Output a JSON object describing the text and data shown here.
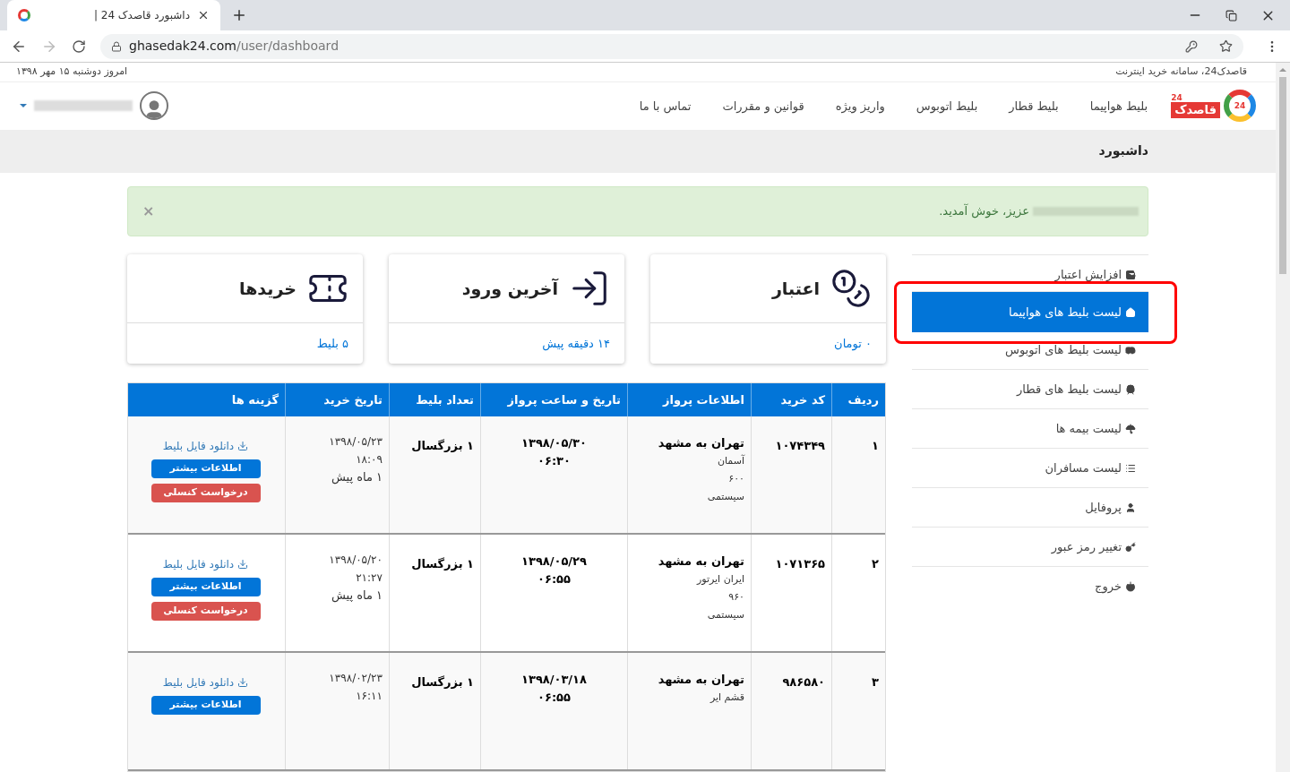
{
  "browser": {
    "tab_title": "داشبورد قاصدک 24 |",
    "url_host": "ghasedak24.com",
    "url_path": "/user/dashboard"
  },
  "topbar": {
    "tagline": "قاصدک24، سامانه خرید اینترنت",
    "today": "امروز دوشنبه ۱۵ مهر ۱۳۹۸"
  },
  "nav": {
    "logo_text": "قاصدک",
    "logo_badge": "24",
    "logo_wordmark_badge": "24",
    "items": [
      "بلیط هواپیما",
      "بلیط قطار",
      "بلیط اتوبوس",
      "واریز ویژه",
      "قوانین و مقررات",
      "تماس با ما"
    ]
  },
  "page_title": "داشبورد",
  "alert": {
    "message": "عزیز، خوش آمدید.",
    "close": "×"
  },
  "stats": [
    {
      "kind": "coins",
      "title": "اعتبار",
      "value": "۰ تومان"
    },
    {
      "kind": "login",
      "title": "آخرین ورود",
      "value": "۱۴ دقیقه پیش"
    },
    {
      "kind": "tickets",
      "title": "خریدها",
      "value": "۵ بلیط"
    }
  ],
  "sidebar": [
    {
      "kind": "wallet",
      "label": "افزایش اعتبار",
      "selected": false
    },
    {
      "kind": "home",
      "label": "لیست بلیط های هواپیما",
      "selected": true
    },
    {
      "kind": "bus",
      "label": "لیست بلیط های اتوبوس",
      "selected": false
    },
    {
      "kind": "train",
      "label": "لیست بلیط های قطار",
      "selected": false
    },
    {
      "kind": "umbrella",
      "label": "لیست بیمه ها",
      "selected": false
    },
    {
      "kind": "list",
      "label": "لیست مسافران",
      "selected": false
    },
    {
      "kind": "user",
      "label": "پروفایل",
      "selected": false
    },
    {
      "kind": "key",
      "label": "تغییر رمز عبور",
      "selected": false
    },
    {
      "kind": "power",
      "label": "خروج",
      "selected": false
    }
  ],
  "table": {
    "columns": [
      "ردیف",
      "کد خرید",
      "اطلاعات پرواز",
      "تاریخ و ساعت پرواز",
      "تعداد بلیط",
      "تاریخ خرید",
      "گزینه ها"
    ],
    "rows": [
      {
        "index": "۱",
        "code": "۱۰۷۴۳۴۹",
        "flight_info": [
          "تهران به مشهد",
          "آسمان",
          "۶۰۰",
          "سیستمی"
        ],
        "flight_datetime": [
          "۱۳۹۸/۰۵/۳۰",
          "۰۶:۳۰"
        ],
        "count": "۱ بزرگسال",
        "purchase": [
          "۱۳۹۸/۰۵/۲۳",
          "۱۸:۰۹",
          "۱ ماه پیش"
        ],
        "actions": [
          {
            "kind": "link",
            "label": "دانلود فایل بلیط"
          },
          {
            "kind": "primary",
            "label": "اطلاعات بیشتر"
          },
          {
            "kind": "danger",
            "label": "درخواست کنسلی"
          }
        ]
      },
      {
        "index": "۲",
        "code": "۱۰۷۱۳۶۵",
        "flight_info": [
          "تهران به مشهد",
          "ایران ایرتور",
          "۹۶۰",
          "سیستمی"
        ],
        "flight_datetime": [
          "۱۳۹۸/۰۵/۲۹",
          "۰۶:۵۵"
        ],
        "count": "۱ بزرگسال",
        "purchase": [
          "۱۳۹۸/۰۵/۲۰",
          "۲۱:۲۷",
          "۱ ماه پیش"
        ],
        "actions": [
          {
            "kind": "link",
            "label": "دانلود فایل بلیط"
          },
          {
            "kind": "primary",
            "label": "اطلاعات بیشتر"
          },
          {
            "kind": "danger",
            "label": "درخواست کنسلی"
          }
        ]
      },
      {
        "index": "۳",
        "code": "۹۸۶۵۸۰",
        "flight_info": [
          "تهران به مشهد",
          "قشم ایر"
        ],
        "flight_datetime": [
          "۱۳۹۸/۰۳/۱۸",
          "۰۶:۵۵"
        ],
        "count": "۱ بزرگسال",
        "purchase": [
          "۱۳۹۸/۰۲/۲۳",
          "۱۶:۱۱"
        ],
        "actions": [
          {
            "kind": "link",
            "label": "دانلود فایل بلیط"
          },
          {
            "kind": "primary",
            "label": "اطلاعات بیشتر"
          }
        ]
      }
    ]
  }
}
